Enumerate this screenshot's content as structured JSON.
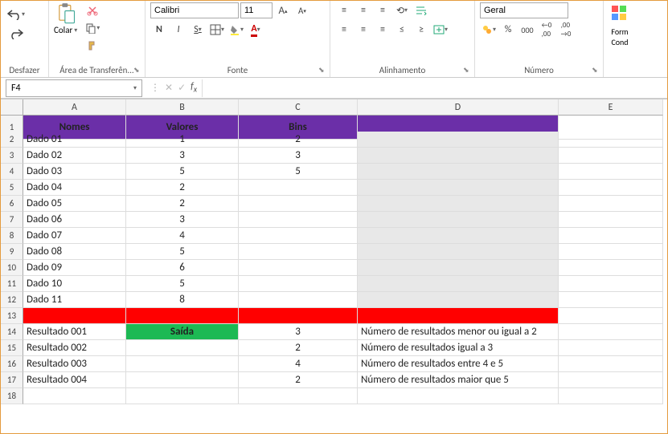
{
  "ribbon": {
    "undo_group": "Desfazer",
    "clipboard_group": "Área de Transferên...",
    "paste_label": "Colar",
    "font_group": "Fonte",
    "font_name": "Calibri",
    "font_size": "11",
    "align_group": "Alinhamento",
    "number_group": "Número",
    "number_format": "Geral",
    "format_label_1": "Form",
    "format_label_2": "Cond"
  },
  "namebox": "F4",
  "formula": "",
  "columns": [
    "A",
    "B",
    "C",
    "D",
    "E"
  ],
  "headers": {
    "a": "Nomes",
    "b": "Valores",
    "c": "Bins"
  },
  "rows": [
    {
      "n": "2",
      "a": "Dado 01",
      "b": "1",
      "c": "2"
    },
    {
      "n": "3",
      "a": "Dado 02",
      "b": "3",
      "c": "3"
    },
    {
      "n": "4",
      "a": "Dado 03",
      "b": "5",
      "c": "5"
    },
    {
      "n": "5",
      "a": "Dado 04",
      "b": "2",
      "c": ""
    },
    {
      "n": "6",
      "a": "Dado 05",
      "b": "2",
      "c": ""
    },
    {
      "n": "7",
      "a": "Dado 06",
      "b": "3",
      "c": ""
    },
    {
      "n": "8",
      "a": "Dado 07",
      "b": "4",
      "c": ""
    },
    {
      "n": "9",
      "a": "Dado 08",
      "b": "5",
      "c": ""
    },
    {
      "n": "10",
      "a": "Dado 09",
      "b": "6",
      "c": ""
    },
    {
      "n": "11",
      "a": "Dado 10",
      "b": "5",
      "c": ""
    },
    {
      "n": "12",
      "a": "Dado 11",
      "b": "8",
      "c": ""
    }
  ],
  "results": [
    {
      "n": "14",
      "a": "Resultado 001",
      "b": "Saída",
      "c": "3",
      "d": "Número de resultados menor ou igual a 2",
      "green": true
    },
    {
      "n": "15",
      "a": "Resultado 002",
      "b": "",
      "c": "2",
      "d": "Número de resultados igual a 3"
    },
    {
      "n": "16",
      "a": "Resultado 003",
      "b": "",
      "c": "4",
      "d": "Número de resultados entre 4 e 5"
    },
    {
      "n": "17",
      "a": "Resultado 004",
      "b": "",
      "c": "2",
      "d": "Número de resultados maior que 5"
    }
  ]
}
